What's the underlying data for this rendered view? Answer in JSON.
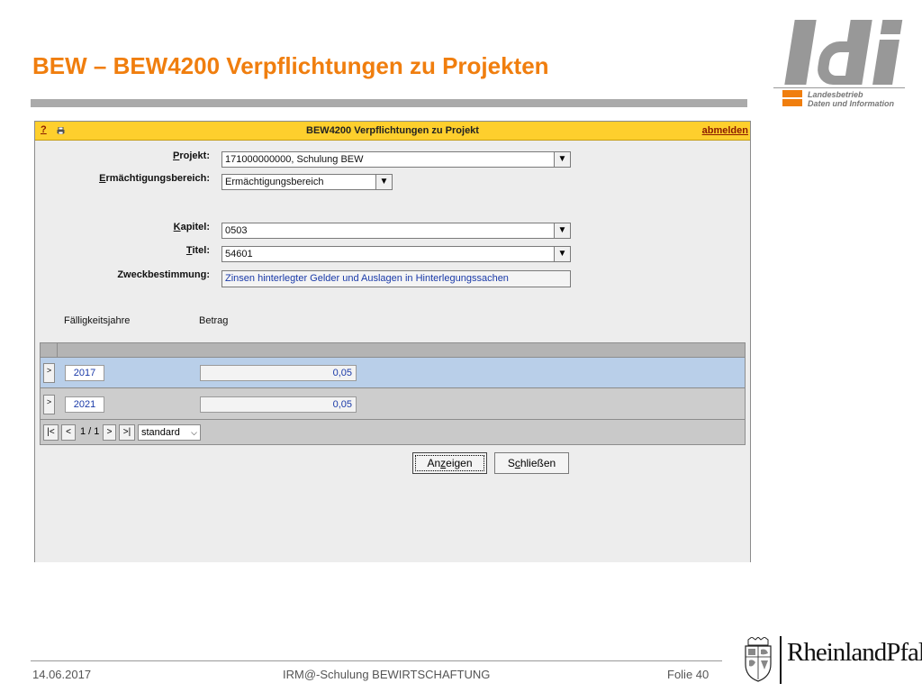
{
  "slide": {
    "title": "BEW – BEW4200 Verpflichtungen zu Projekten"
  },
  "logo": {
    "brand": "ldi",
    "line1": "Landesbetrieb",
    "line2": "Daten und Information"
  },
  "app": {
    "help_label": "?",
    "print_icon": "printer-icon",
    "title": "BEW4200 Verpflichtungen zu Projekt",
    "logout_label": "abmelden",
    "form": {
      "projekt_label_key": "P",
      "projekt_label_rest": "rojekt:",
      "projekt_value": "171000000000, Schulung BEW",
      "ermaecht_label_key": "E",
      "ermaecht_label_rest": "rmächtigungsbereich:",
      "ermaecht_value": "Ermächtigungsbereich",
      "kapitel_label_key": "K",
      "kapitel_label_rest": "apitel:",
      "kapitel_value": "0503",
      "titel_label_key": "T",
      "titel_label_rest": "itel:",
      "titel_value": "54601",
      "zweck_label": "Zweckbestimmung:",
      "zweck_value": "Zinsen hinterlegter Gelder und Auslagen in Hinterlegungssachen"
    },
    "table": {
      "col_year": "Fälligkeitsjahre",
      "col_amount": "Betrag",
      "rows": [
        {
          "arrow": ">",
          "year": "2017",
          "amount": "0,05"
        },
        {
          "arrow": ">",
          "year": "2021",
          "amount": "0,05"
        }
      ]
    },
    "pager": {
      "first": "|<",
      "prev": "<",
      "page": "1 / 1",
      "next": ">",
      "last": ">|",
      "view": "standard"
    },
    "buttons": {
      "anzeigen_pre": "An",
      "anzeigen_key": "z",
      "anzeigen_post": "eigen",
      "schliessen_pre": "S",
      "schliessen_key": "c",
      "schliessen_post": "hließen"
    }
  },
  "footer": {
    "date": "14.06.2017",
    "center": "IRM@-Schulung BEWIRTSCHAFTUNG",
    "page": "Folie 40",
    "state_logo": "RheinlandPfalz",
    "crest_icon": "coat-of-arms-icon"
  },
  "colors": {
    "title_orange": "#f07e0e",
    "header_yellow": "#fecf2d",
    "selected_row": "#b9cfe9",
    "value_blue": "#1a3aa8"
  }
}
